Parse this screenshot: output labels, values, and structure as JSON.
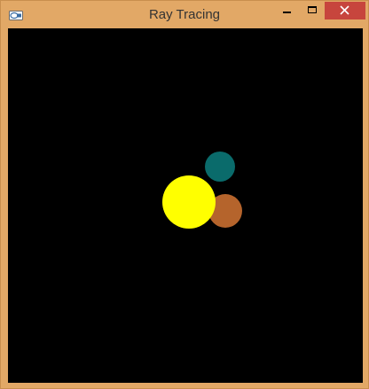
{
  "window": {
    "title": "Ray Tracing",
    "app_icon": "app-logo-icon",
    "controls": {
      "minimize_icon": "minimize-icon",
      "maximize_icon": "maximize-icon",
      "close_icon": "close-icon"
    }
  },
  "scene": {
    "background_color": "#000000",
    "spheres": [
      {
        "name": "teal-sphere",
        "color": "#0a6b6b"
      },
      {
        "name": "orange-sphere",
        "color": "#b5642c"
      },
      {
        "name": "yellow-sphere",
        "color": "#ffff00"
      }
    ]
  },
  "colors": {
    "window_frame": "#e2a866",
    "close_button": "#c7453d"
  }
}
